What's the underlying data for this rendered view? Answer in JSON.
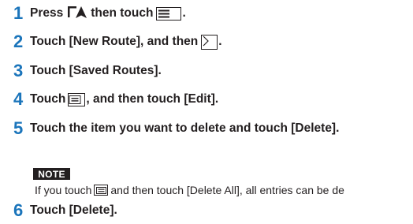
{
  "steps": [
    {
      "num": "1",
      "text_before": "Press",
      "text_middle": "then touch",
      "text_after": "."
    },
    {
      "num": "2",
      "text_before": "Touch [New Route], and then",
      "text_after": "."
    },
    {
      "num": "3",
      "text": "Touch [Saved Routes]."
    },
    {
      "num": "4",
      "text_before": "Touch",
      "text_after": ", and then touch [Edit]."
    },
    {
      "num": "5",
      "text": "Touch the item you want to delete and touch [Delete]."
    },
    {
      "num": "6",
      "text": "Touch [Delete]."
    }
  ],
  "note": {
    "label": "NOTE",
    "text_before": "If you touch",
    "text_after": "and then touch [Delete All], all entries can be de"
  },
  "icons": {
    "navigation": "navigation-icon",
    "menu": "menu-icon",
    "arrow": "chevron-right-icon",
    "list": "list-icon"
  },
  "colors": {
    "step_number": "#1b75bb",
    "text": "#231f20",
    "note_label_bg": "#231f20"
  }
}
